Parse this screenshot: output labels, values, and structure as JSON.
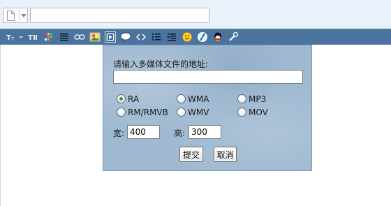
{
  "header": {
    "doc_icon": "document-icon",
    "title_value": ""
  },
  "toolbar": {
    "icons": [
      "font-size-icon",
      "font-family-icon",
      "color-grid-icon",
      "justify-icon",
      "link-icon",
      "image-icon",
      "media-icon",
      "comment-icon",
      "code-icon",
      "list-icon",
      "indent-icon",
      "emoticon-icon",
      "flash-icon",
      "qq-icon",
      "tools-icon"
    ]
  },
  "media_dialog": {
    "prompt": "请输入多媒体文件的地址:",
    "url_value": "",
    "formats": [
      {
        "label": "RA",
        "selected": true
      },
      {
        "label": "WMA",
        "selected": false
      },
      {
        "label": "MP3",
        "selected": false
      },
      {
        "label": "RM/RMVB",
        "selected": false
      },
      {
        "label": "WMV",
        "selected": false
      },
      {
        "label": "MOV",
        "selected": false
      }
    ],
    "width_label": "宽:",
    "width_value": "400",
    "height_label": "高:",
    "height_value": "300",
    "submit_label": "提交",
    "cancel_label": "取消"
  },
  "colors": {
    "toolbar_bg": "#4b739f",
    "dialog_bg": "#9fb9d1",
    "radio_selected": "#2e9a2e"
  }
}
